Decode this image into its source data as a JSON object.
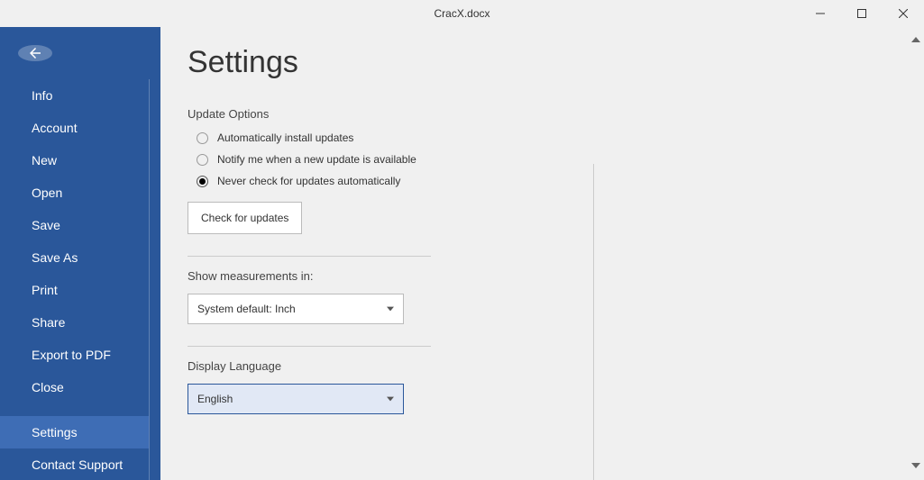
{
  "window": {
    "title": "CracX.docx"
  },
  "sidebar": {
    "items": [
      {
        "label": "Info"
      },
      {
        "label": "Account"
      },
      {
        "label": "New"
      },
      {
        "label": "Open"
      },
      {
        "label": "Save"
      },
      {
        "label": "Save As"
      },
      {
        "label": "Print"
      },
      {
        "label": "Share"
      },
      {
        "label": "Export to PDF"
      },
      {
        "label": "Close"
      },
      {
        "label": "Settings"
      },
      {
        "label": "Contact Support"
      }
    ]
  },
  "main": {
    "title": "Settings",
    "update": {
      "heading": "Update Options",
      "opt1": "Automatically install updates",
      "opt2": "Notify me when a new update is available",
      "opt3": "Never check for updates automatically",
      "check_btn": "Check for updates"
    },
    "measure": {
      "heading": "Show measurements in:",
      "value": "System default: Inch"
    },
    "lang": {
      "heading": "Display Language",
      "value": "English"
    }
  }
}
